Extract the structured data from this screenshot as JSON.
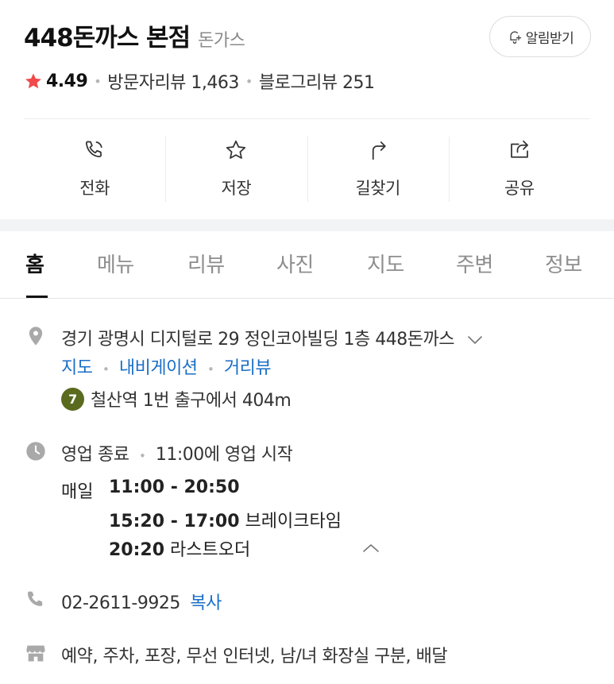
{
  "place": {
    "name": "448돈까스 본점",
    "category": "돈가스",
    "alarm_label": "알림받기"
  },
  "rating": {
    "score": "4.49",
    "visitor_reviews": "방문자리뷰 1,463",
    "blog_reviews": "블로그리뷰 251",
    "star_color": "#f04a4a"
  },
  "actions": [
    {
      "label": "전화",
      "icon": "phone-icon"
    },
    {
      "label": "저장",
      "icon": "star-outline-icon"
    },
    {
      "label": "길찾기",
      "icon": "directions-icon"
    },
    {
      "label": "공유",
      "icon": "share-icon"
    }
  ],
  "tabs": [
    {
      "label": "홈",
      "active": true
    },
    {
      "label": "메뉴"
    },
    {
      "label": "리뷰"
    },
    {
      "label": "사진"
    },
    {
      "label": "지도"
    },
    {
      "label": "주변"
    },
    {
      "label": "정보"
    }
  ],
  "address": {
    "text": "경기 광명시 디지털로 29 정인코아빌딩 1층 448돈까스",
    "links": [
      "지도",
      "내비게이션",
      "거리뷰"
    ],
    "metro_line": "7",
    "metro_line_color": "#5a6a1f",
    "metro_text": "철산역 1번 출구에서 404m"
  },
  "hours": {
    "status": "영업 종료",
    "next_open": "11:00에 영업 시작",
    "day": "매일",
    "open_time": "11:00 - 20:50",
    "break_time": "15:20 - 17:00",
    "break_label": "브레이크타임",
    "last_order_time": "20:20",
    "last_order_label": "라스트오더"
  },
  "phone": {
    "number": "02-2611-9925",
    "copy_label": "복사"
  },
  "amenities": {
    "text": "예약, 주차, 포장, 무선 인터넷, 남/녀 화장실 구분, 배달"
  },
  "colors": {
    "link": "#1a6ec7",
    "icon_gray": "#a9a9a9"
  }
}
